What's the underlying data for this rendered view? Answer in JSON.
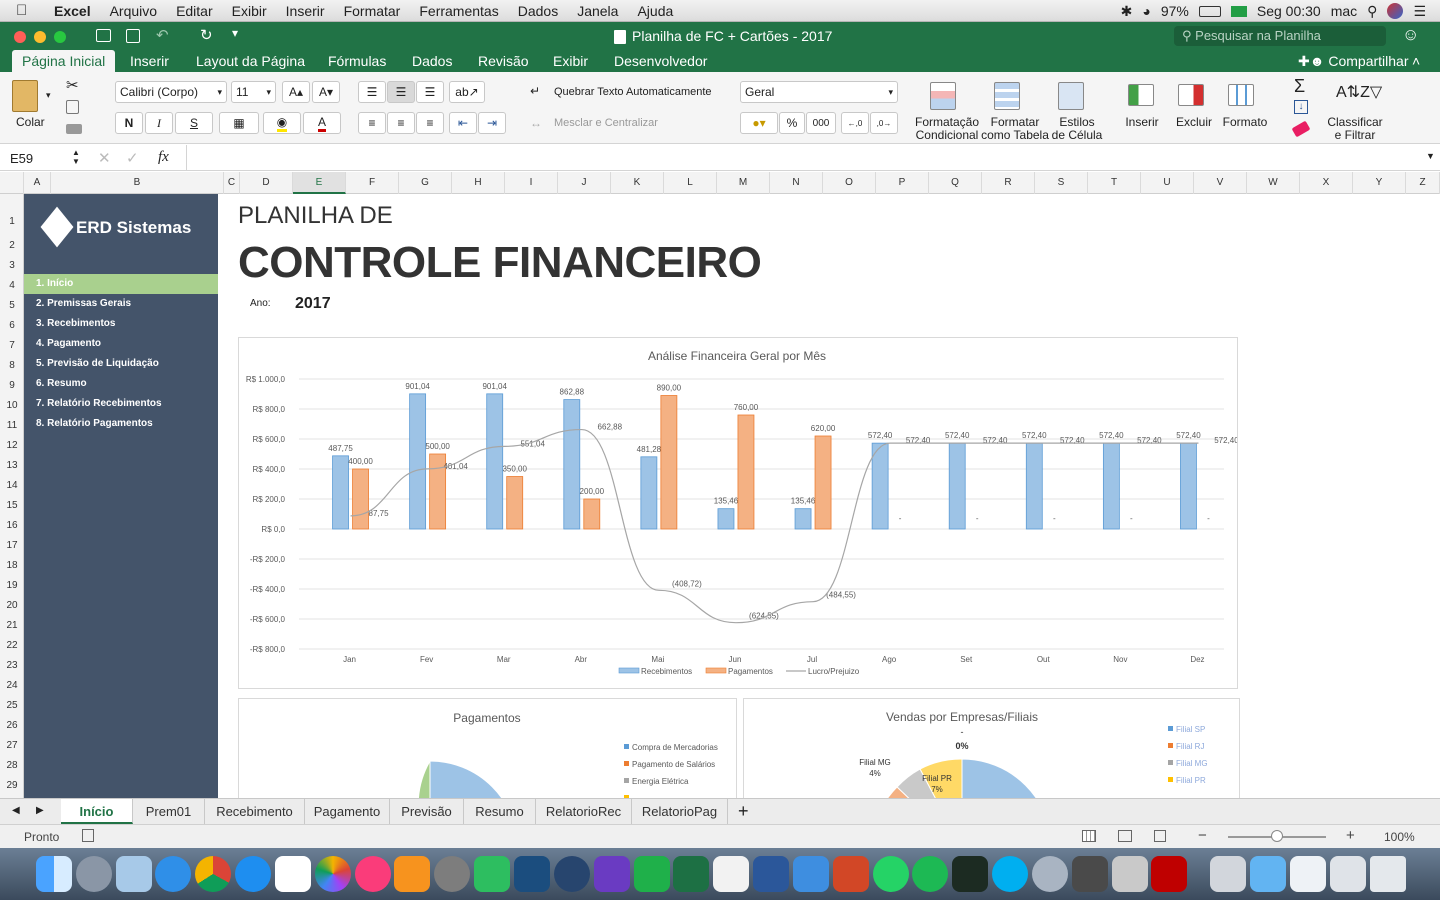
{
  "menubar": {
    "app": "Excel",
    "items": [
      "Arquivo",
      "Editar",
      "Exibir",
      "Inserir",
      "Formatar",
      "Ferramentas",
      "Dados",
      "Janela",
      "Ajuda"
    ],
    "battery": "97%",
    "clock": "Seg 00:30",
    "user": "mac"
  },
  "window": {
    "title": "Planilha de FC + Cartões - 2017",
    "search_placeholder": "Pesquisar na Planilha"
  },
  "ribbon_tabs": [
    "Página Inicial",
    "Inserir",
    "Layout da Página",
    "Fórmulas",
    "Dados",
    "Revisão",
    "Exibir",
    "Desenvolvedor"
  ],
  "share_label": "Compartilhar",
  "ribbon": {
    "paste_label": "Colar",
    "font_name": "Calibri (Corpo)",
    "font_size": "11",
    "bold": "N",
    "italic": "I",
    "underline": "S",
    "wrap_text": "Quebrar Texto Automaticamente",
    "merge_center": "Mesclar e Centralizar",
    "number_format": "Geral",
    "percent": "%",
    "thousands": "000",
    "cond_format": "Formatação\nCondicional",
    "format_table": "Formatar\ncomo Tabela",
    "cell_styles": "Estilos\nde Célula",
    "insert": "Inserir",
    "delete": "Excluir",
    "format": "Formato",
    "sort_filter": "Classificar\ne Filtrar"
  },
  "formula_bar": {
    "name_box": "E59",
    "fx": "fx",
    "value": ""
  },
  "columns": [
    "A",
    "B",
    "C",
    "D",
    "E",
    "F",
    "G",
    "H",
    "I",
    "J",
    "K",
    "L",
    "M",
    "N",
    "O",
    "P",
    "Q",
    "R",
    "S",
    "T",
    "U",
    "V",
    "W",
    "X",
    "Y",
    "Z"
  ],
  "rows": [
    "1",
    "2",
    "3",
    "4",
    "5",
    "6",
    "7",
    "8",
    "9",
    "10",
    "11",
    "12",
    "13",
    "14",
    "15",
    "16",
    "17",
    "18",
    "19",
    "20",
    "21",
    "22",
    "23",
    "24",
    "25",
    "26",
    "27",
    "28",
    "29"
  ],
  "sidebar": {
    "brand": "ERD Sistemas",
    "items": [
      "1. Início",
      "2. Premissas Gerais",
      "3. Recebimentos",
      "4. Pagamento",
      "5. Previsão de Liquidação",
      "6. Resumo",
      "7. Relatório Recebimentos",
      "8. Relatório Pagamentos"
    ],
    "active_index": 0
  },
  "header": {
    "line1": "PLANILHA DE",
    "line2": "CONTROLE FINANCEIRO",
    "year_label": "Ano:",
    "year": "2017"
  },
  "chart_data": [
    {
      "type": "bar",
      "title": "Análise Financeira Geral por Mês",
      "categories": [
        "Jan",
        "Fev",
        "Mar",
        "Abr",
        "Mai",
        "Jun",
        "Jul",
        "Ago",
        "Set",
        "Out",
        "Nov",
        "Dez"
      ],
      "y_ticks": [
        "R$ 1.000,0",
        "R$ 800,0",
        "R$ 600,0",
        "R$ 400,0",
        "R$ 200,0",
        "R$ 0,0",
        "-R$ 200,0",
        "-R$ 400,0",
        "-R$ 600,0",
        "-R$ 800,0"
      ],
      "ylim": [
        -800,
        1000
      ],
      "series": [
        {
          "name": "Recebimentos",
          "color": "#9dc3e6",
          "values": [
            487.75,
            901.04,
            901.04,
            862.88,
            481.28,
            135.46,
            135.46,
            572.4,
            572.4,
            572.4,
            572.4,
            572.4
          ],
          "labels": [
            "487,75",
            "901,04",
            "901,04",
            "862,88",
            "481,28",
            "135,46",
            "135,46",
            "572,40",
            "572,40",
            "572,40",
            "572,40",
            "572,40"
          ]
        },
        {
          "name": "Pagamentos",
          "color": "#f4b183",
          "values": [
            400,
            500,
            350,
            200,
            890,
            760,
            620,
            0,
            0,
            0,
            0,
            0
          ],
          "labels": [
            "400,00",
            "500,00",
            "350,00",
            "200,00",
            "890,00",
            "760,00",
            "620,00",
            "-",
            "-",
            "-",
            "-",
            "-"
          ]
        },
        {
          "name": "Lucro/Prejuizo",
          "color": "#a6a6a6",
          "values": [
            87.75,
            401.04,
            551.04,
            662.88,
            -408.72,
            -624.55,
            -484.55,
            572.4,
            572.4,
            572.4,
            572.4,
            572.4
          ],
          "labels": [
            "87,75",
            "401,04",
            "551,04",
            "662,88",
            "(408,72)",
            "(624,55)",
            "(484,55)",
            "572,40",
            "572,40",
            "572,40",
            "572,40",
            "572,40"
          ]
        }
      ]
    },
    {
      "type": "pie",
      "title": "Pagamentos",
      "legend": [
        {
          "name": "Compra de Mercadorias",
          "color": "#5b9bd5"
        },
        {
          "name": "Pagamento de Salários",
          "color": "#ed7d31"
        },
        {
          "name": "Energia Elétrica",
          "color": "#a5a5a5"
        }
      ]
    },
    {
      "type": "pie",
      "title": "Vendas por Empresas/Filiais",
      "legend": [
        {
          "name": "Filial SP",
          "color": "#5b9bd5"
        },
        {
          "name": "Filial RJ",
          "color": "#ed7d31"
        },
        {
          "name": "Filial MG",
          "color": "#a5a5a5"
        },
        {
          "name": "Filial PR",
          "color": "#ffc000"
        }
      ],
      "slice_labels": [
        {
          "name": "Filial MG",
          "pct": "4%"
        },
        {
          "name": "Filial PR",
          "pct": "7%"
        }
      ],
      "top_label": "-",
      "top_pct": "0%"
    }
  ],
  "sheet_tabs": [
    "Início",
    "Prem01",
    "Recebimento",
    "Pagamento",
    "Previsão",
    "Resumo",
    "RelatorioRec",
    "RelatorioPag"
  ],
  "status": {
    "ready": "Pronto",
    "zoom": "100%"
  }
}
